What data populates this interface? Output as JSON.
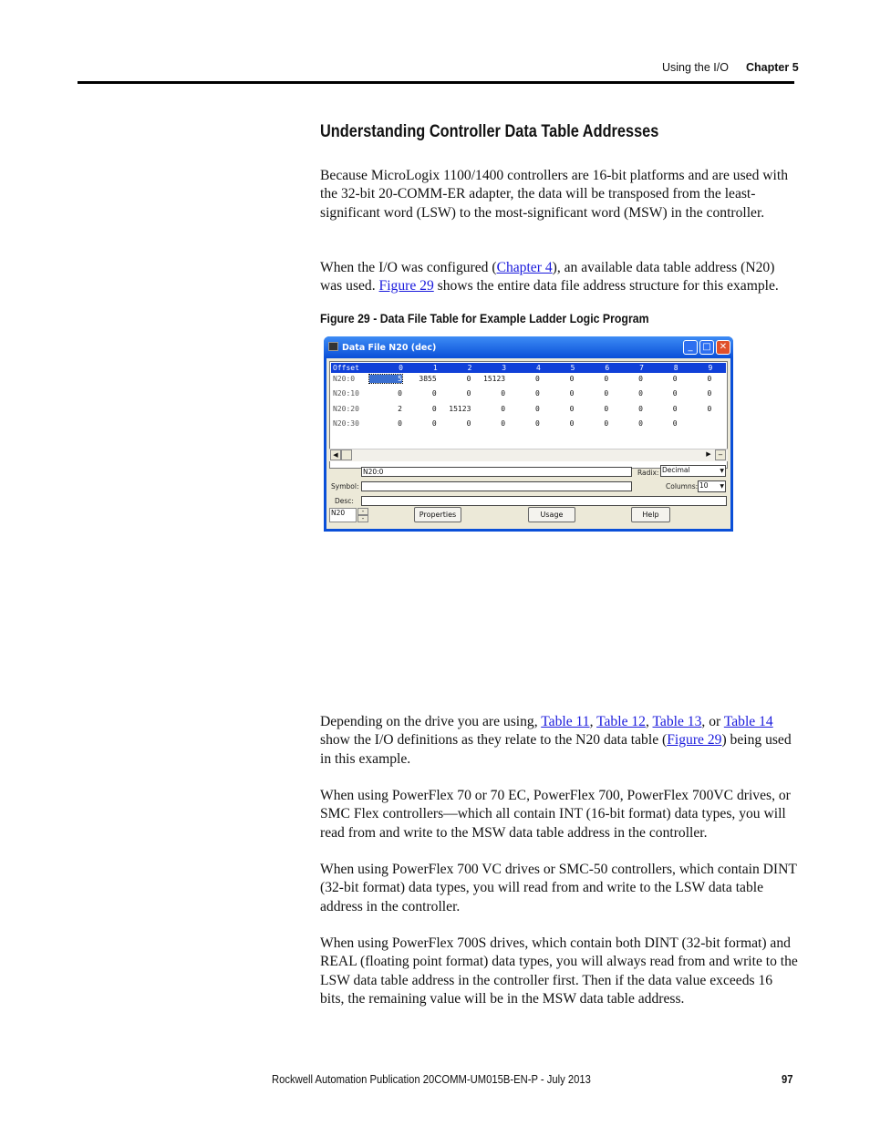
{
  "header": {
    "section": "Using the I/O",
    "chapter": "Chapter 5"
  },
  "title": "Understanding Controller Data Table Addresses",
  "p1": "Because MicroLogix 1100/1400 controllers are 16-bit platforms and are used with the 32-bit 20-COMM-ER adapter, the data will be transposed from the least-significant word (LSW) to the most-significant word (MSW) in the controller.",
  "p2": {
    "a": "When the I/O was configured (",
    "link1": "Chapter 4",
    "b": "), an available data table address (N20) was used. ",
    "link2": "Figure 29",
    "c": " shows the entire data file address structure for this example."
  },
  "figure_caption": "Figure 29 - Data File Table for Example Ladder Logic Program",
  "window": {
    "title": "Data File N20 (dec)",
    "minimize": "_",
    "maximize": "□",
    "close": "✕",
    "columns": [
      "Offset",
      "0",
      "1",
      "2",
      "3",
      "4",
      "5",
      "6",
      "7",
      "8",
      "9"
    ],
    "rows": [
      {
        "offset": "N20:0",
        "values": [
          "5",
          "3855",
          "0",
          "15123",
          "0",
          "0",
          "0",
          "0",
          "0",
          "0"
        ]
      },
      {
        "offset": "N20:10",
        "values": [
          "0",
          "0",
          "0",
          "0",
          "0",
          "0",
          "0",
          "0",
          "0",
          "0"
        ]
      },
      {
        "offset": "N20:20",
        "values": [
          "2",
          "0",
          "15123",
          "0",
          "0",
          "0",
          "0",
          "0",
          "0",
          "0"
        ]
      },
      {
        "offset": "N20:30",
        "values": [
          "0",
          "0",
          "0",
          "0",
          "0",
          "0",
          "0",
          "0",
          "0",
          ""
        ]
      }
    ],
    "address_value": "N20:0",
    "radix_label": "Radix:",
    "radix_value": "Decimal",
    "symbol_label": "Symbol:",
    "symbol_value": "",
    "columns_label": "Columns:",
    "columns_value": "10",
    "desc_label": "Desc:",
    "desc_value": "",
    "file_value": "N20",
    "properties": "Properties",
    "usage": "Usage",
    "help": "Help"
  },
  "p3": {
    "a": "Depending on the drive you are using, ",
    "t11": "Table 11",
    ",": ", ",
    "t12": "Table 12",
    "c2": ", ",
    "t13": "Table 13",
    "or": ", or ",
    "t14": "Table 14",
    "b": " show the I/O definitions as they relate to the N20 data table (",
    "fig": "Figure 29",
    "c": ") being used in this example."
  },
  "p4": "When using PowerFlex 70 or 70 EC, PowerFlex 700, PowerFlex 700VC drives, or SMC Flex controllers—which all contain INT (16-bit format) data types, you will read from and write to the MSW data table address in the controller.",
  "p5": "When using PowerFlex 700 VC drives or SMC-50 controllers, which contain DINT (32-bit format) data types, you will read from and write to the LSW data table address in the controller.",
  "p6": "When using PowerFlex 700S drives, which contain both DINT (32-bit format) and REAL (floating point format) data types, you will always read from and write to the LSW data table address in the controller first. Then if the data value exceeds 16 bits, the remaining value will be in the MSW data table address.",
  "footer": {
    "publication": "Rockwell Automation Publication  20COMM-UM015B-EN-P - July 2013",
    "page": "97"
  }
}
